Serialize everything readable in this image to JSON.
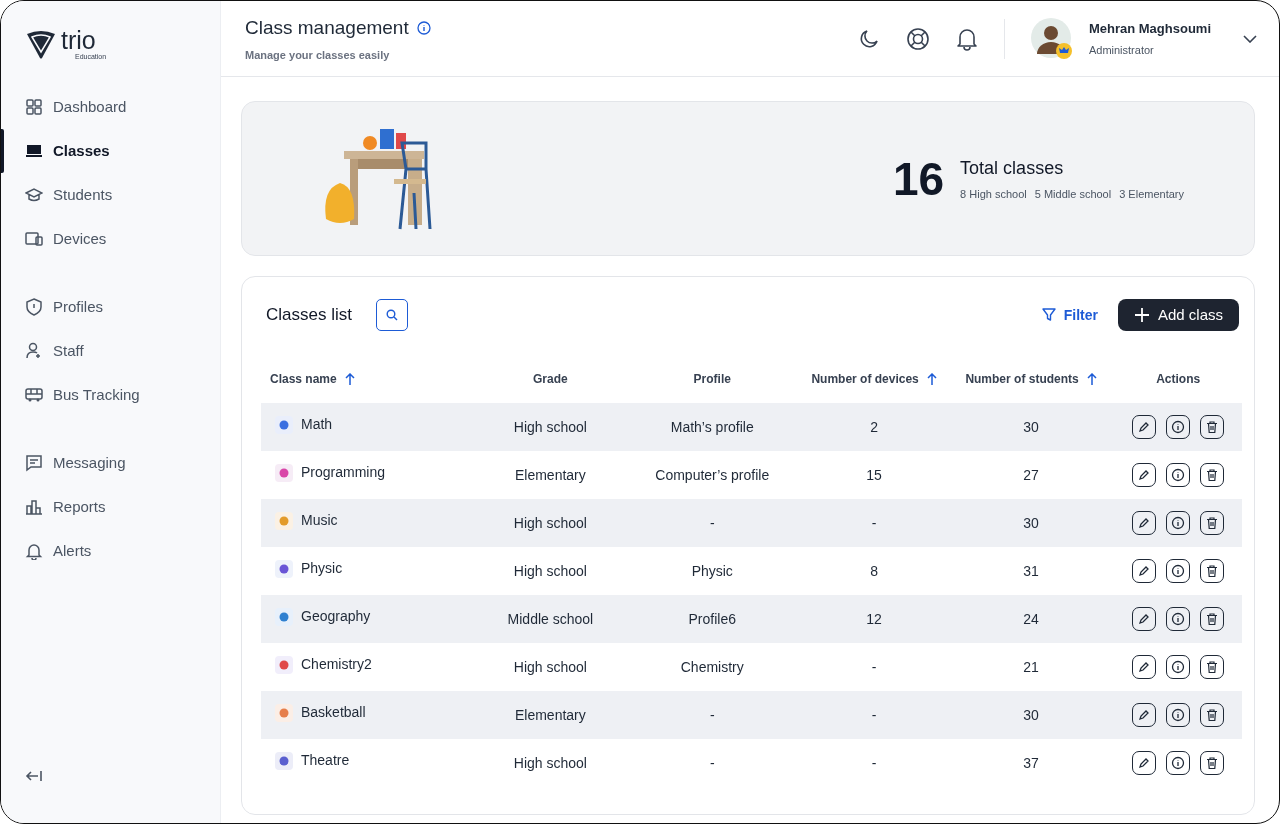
{
  "brand": {
    "name": "trio",
    "tagline": "Education"
  },
  "sidebar": {
    "groups": [
      [
        {
          "label": "Dashboard",
          "selected": false
        },
        {
          "label": "Classes",
          "selected": true
        },
        {
          "label": "Students",
          "selected": false
        },
        {
          "label": "Devices",
          "selected": false
        }
      ],
      [
        {
          "label": "Profiles",
          "selected": false
        },
        {
          "label": "Staff",
          "selected": false
        },
        {
          "label": "Bus Tracking",
          "selected": false
        }
      ],
      [
        {
          "label": "Messaging",
          "selected": false
        },
        {
          "label": "Reports",
          "selected": false
        },
        {
          "label": "Alerts",
          "selected": false
        }
      ]
    ]
  },
  "header": {
    "title": "Class management",
    "subtitle": "Manage your classes easily",
    "user": {
      "name": "Mehran Maghsoumi",
      "role": "Administrator"
    }
  },
  "summary": {
    "count": "16",
    "label": "Total classes",
    "breakdown": [
      "8 High school",
      "5 Middle school",
      "3 Elementary"
    ]
  },
  "classes_list": {
    "title": "Classes list",
    "filter": "Filter",
    "add_button": "Add class",
    "columns": [
      {
        "label": "Class name",
        "sortable": true
      },
      {
        "label": "Grade",
        "sortable": false
      },
      {
        "label": "Profile",
        "sortable": false
      },
      {
        "label": "Number of devices",
        "sortable": true
      },
      {
        "label": "Number of students",
        "sortable": true
      },
      {
        "label": "Actions",
        "sortable": false
      }
    ],
    "rows": [
      {
        "name": "Math",
        "grade": "High school",
        "profile": "Math’s profile",
        "devices": "2",
        "students": "30"
      },
      {
        "name": "Programming",
        "grade": "Elementary",
        "profile": "Computer’s profile",
        "devices": "15",
        "students": "27"
      },
      {
        "name": "Music",
        "grade": "High school",
        "profile": "-",
        "devices": "-",
        "students": "30"
      },
      {
        "name": "Physic",
        "grade": "High school",
        "profile": "Physic",
        "devices": "8",
        "students": "31"
      },
      {
        "name": "Geography",
        "grade": "Middle school",
        "profile": "Profile6",
        "devices": "12",
        "students": "24"
      },
      {
        "name": "Chemistry2",
        "grade": "High school",
        "profile": "Chemistry",
        "devices": "-",
        "students": "21"
      },
      {
        "name": "Basketball",
        "grade": "Elementary",
        "profile": "-",
        "devices": "-",
        "students": "30"
      },
      {
        "name": "Theatre",
        "grade": "High school",
        "profile": "-",
        "devices": "-",
        "students": "37"
      }
    ]
  }
}
